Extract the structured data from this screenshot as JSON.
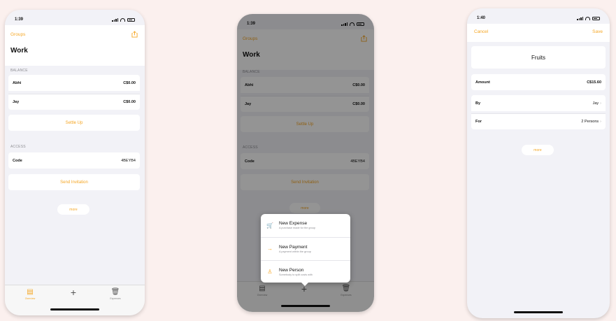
{
  "colors": {
    "accent": "#f5a623",
    "background": "#fbf0ee"
  },
  "screen1": {
    "time": "1:39",
    "nav_left": "Groups",
    "title": "Work",
    "balance_header": "BALANCE",
    "balances": [
      {
        "name": "Abhi",
        "value": "C$0.00"
      },
      {
        "name": "Jay",
        "value": "C$0.00"
      }
    ],
    "settle_up": "Settle Up",
    "access_header": "ACCESS",
    "code_label": "Code",
    "code_value": "4BEYB4",
    "send_invitation": "Send Invitation",
    "more": "more",
    "tabs": [
      {
        "label": "Overview",
        "icon": "overview-icon"
      },
      {
        "label": "",
        "icon": "plus-icon"
      },
      {
        "label": "Expenses",
        "icon": "trash-icon"
      }
    ]
  },
  "screen2": {
    "time": "1:39",
    "nav_left": "Groups",
    "title": "Work",
    "balance_header": "BALANCE",
    "balances": [
      {
        "name": "Abhi",
        "value": "C$0.00"
      },
      {
        "name": "Jay",
        "value": "C$0.00"
      }
    ],
    "settle_up": "Settle Up",
    "access_header": "ACCESS",
    "code_label": "Code",
    "code_value": "4BEYB4",
    "send_invitation": "Send Invitation",
    "more": "more",
    "menu": [
      {
        "title": "New Expense",
        "subtitle": "A purchase made for the group",
        "icon": "cart-icon"
      },
      {
        "title": "New Payment",
        "subtitle": "A payment within the group",
        "icon": "arrow-icon"
      },
      {
        "title": "New Person",
        "subtitle": "Somebody to split costs with",
        "icon": "person-icon"
      }
    ],
    "tabs": [
      {
        "label": "Overview"
      },
      {
        "label": ""
      },
      {
        "label": "Expenses"
      }
    ]
  },
  "screen3": {
    "time": "1:40",
    "cancel": "Cancel",
    "save": "Save",
    "expense_title": "Fruits",
    "amount_label": "Amount",
    "amount_value": "C$15.60",
    "by_label": "By",
    "by_value": "Jay",
    "for_label": "For",
    "for_value": "2 Persons",
    "more": "more"
  }
}
